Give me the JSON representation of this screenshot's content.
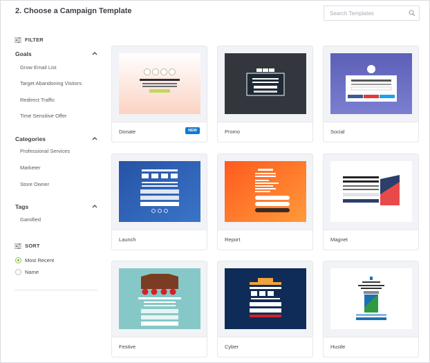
{
  "header": {
    "title": "2. Choose a Campaign Template",
    "search_placeholder": "Search Templates"
  },
  "sidebar": {
    "filter_label": "FILTER",
    "goals": {
      "title": "Goals",
      "items": [
        "Grow Email List",
        "Target Abandoning Visitors",
        "Redirect Traffic",
        "Time Sensitive Offer"
      ]
    },
    "categories": {
      "title": "Categories",
      "items": [
        "Professional Services",
        "Marketer",
        "Store Owner"
      ]
    },
    "tags": {
      "title": "Tags",
      "items": [
        "Gamified"
      ]
    },
    "sort_label": "SORT",
    "sort_options": [
      {
        "label": "Most Recent",
        "selected": true
      },
      {
        "label": "Name",
        "selected": false
      }
    ]
  },
  "templates": [
    {
      "name": "Donate",
      "badge": "NEW"
    },
    {
      "name": "Promo"
    },
    {
      "name": "Social"
    },
    {
      "name": "Launch"
    },
    {
      "name": "Report"
    },
    {
      "name": "Magnet"
    },
    {
      "name": "Festive"
    },
    {
      "name": "Cyber"
    },
    {
      "name": "Hustle"
    }
  ],
  "colors": {
    "badge_blue": "#1279d3",
    "radio_green": "#8bc34a",
    "card_bg": "#f2f3f6"
  }
}
